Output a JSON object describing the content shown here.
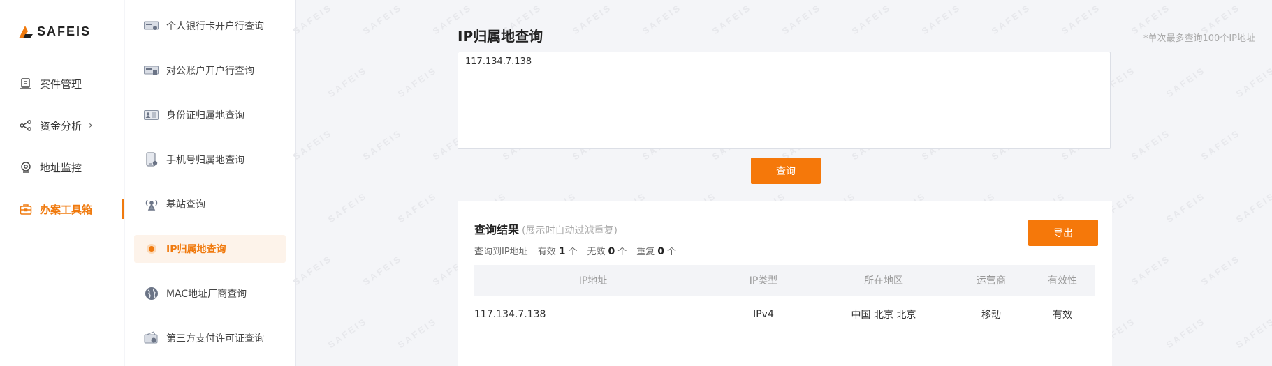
{
  "brand": {
    "name": "SAFEIS",
    "accent": "#f07a0e"
  },
  "nav": {
    "items": [
      {
        "label": "案件管理",
        "icon": "case-icon"
      },
      {
        "label": "资金分析",
        "icon": "flow-icon",
        "chevron": "›"
      },
      {
        "label": "地址监控",
        "icon": "monitor-icon"
      },
      {
        "label": "办案工具箱",
        "icon": "toolbox-icon",
        "active": true
      }
    ]
  },
  "subnav": {
    "items": [
      {
        "label": "个人银行卡开户行查询",
        "icon": "bank-card-icon"
      },
      {
        "label": "对公账户开户行查询",
        "icon": "corporate-account-icon"
      },
      {
        "label": "身份证归属地查询",
        "icon": "id-card-icon"
      },
      {
        "label": "手机号归属地查询",
        "icon": "phone-icon"
      },
      {
        "label": "基站查询",
        "icon": "base-station-icon"
      },
      {
        "label": "IP归属地查询",
        "icon": "ip-location-icon",
        "active": true
      },
      {
        "label": "MAC地址厂商查询",
        "icon": "globe-icon"
      },
      {
        "label": "第三方支付许可证查询",
        "icon": "payment-license-icon"
      }
    ]
  },
  "main": {
    "title": "IP归属地查询",
    "hint": "*单次最多查询100个IP地址",
    "input_value": "117.134.7.138",
    "query_button": "查询"
  },
  "result": {
    "title": "查询结果",
    "subtitle": "(展示时自动过滤重复)",
    "export_button": "导出",
    "stats": {
      "found_label": "查询到IP地址",
      "valid_label": "有效",
      "valid_count": "1",
      "invalid_label": "无效",
      "invalid_count": "0",
      "duplicate_label": "重复",
      "duplicate_count": "0",
      "unit": "个"
    },
    "columns": [
      "IP地址",
      "IP类型",
      "所在地区",
      "运营商",
      "有效性"
    ],
    "rows": [
      [
        "117.134.7.138",
        "IPv4",
        "中国 北京 北京",
        "移动",
        "有效"
      ]
    ]
  },
  "watermark": "SAFEIS"
}
